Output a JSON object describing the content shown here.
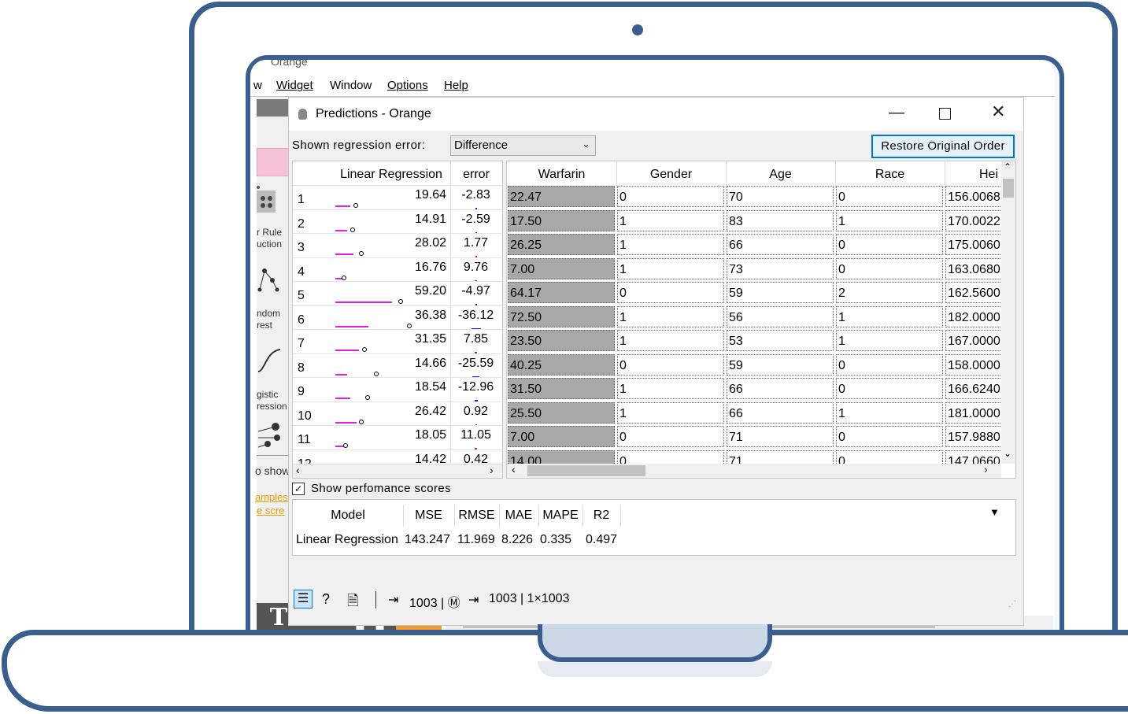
{
  "app": {
    "title": "Orange"
  },
  "menu": [
    "w",
    "Widget",
    "Window",
    "Options",
    "Help"
  ],
  "sidebar": {
    "labels": [
      "r Rule\nuction",
      "ndom\nrest",
      "gistic\nression"
    ],
    "show_label": "o show",
    "link1": "amples",
    "link2": "e scre"
  },
  "dialog": {
    "title": "Predictions - Orange",
    "error_label": "Shown regression error:",
    "error_value": "Difference",
    "restore_button": "Restore Original Order"
  },
  "pred_table": {
    "headers": [
      "Linear Regression",
      "error"
    ],
    "rows": [
      {
        "idx": "1",
        "pred": "19.64",
        "err": "-2.83",
        "bar": 0.1,
        "dot": 0.12,
        "ecolor": "#1a1aff",
        "ew": 2
      },
      {
        "idx": "2",
        "pred": "14.91",
        "err": "-2.59",
        "bar": 0.08,
        "dot": 0.1,
        "ecolor": "#1a1aff",
        "ew": 2
      },
      {
        "idx": "3",
        "pred": "28.02",
        "err": "1.77",
        "bar": 0.12,
        "dot": 0.16,
        "ecolor": "#e02020",
        "ew": 2
      },
      {
        "idx": "4",
        "pred": "16.76",
        "err": "9.76",
        "bar": 0.06,
        "dot": 0.04,
        "ecolor": "#e02020",
        "ew": 3
      },
      {
        "idx": "5",
        "pred": "59.20",
        "err": "-4.97",
        "bar": 0.38,
        "dot": 0.42,
        "ecolor": "#1a1aff",
        "ew": 2
      },
      {
        "idx": "6",
        "pred": "36.38",
        "err": "-36.12",
        "bar": 0.22,
        "dot": 0.48,
        "ecolor": "#1a1aff",
        "ew": 12
      },
      {
        "idx": "7",
        "pred": "31.35",
        "err": "7.85",
        "bar": 0.16,
        "dot": 0.18,
        "ecolor": "#e02020",
        "ew": 3
      },
      {
        "idx": "8",
        "pred": "14.66",
        "err": "-25.59",
        "bar": 0.08,
        "dot": 0.26,
        "ecolor": "#1a1aff",
        "ew": 9
      },
      {
        "idx": "9",
        "pred": "18.54",
        "err": "-12.96",
        "bar": 0.1,
        "dot": 0.2,
        "ecolor": "#1a1aff",
        "ew": 4
      },
      {
        "idx": "10",
        "pred": "26.42",
        "err": "0.92",
        "bar": 0.14,
        "dot": 0.16,
        "ecolor": "#e02020",
        "ew": 2
      },
      {
        "idx": "11",
        "pred": "18.05",
        "err": "11.05",
        "bar": 0.06,
        "dot": 0.05,
        "ecolor": "#e02020",
        "ew": 3
      },
      {
        "idx": "12",
        "pred": "14.42",
        "err": "0.42",
        "bar": 0.07,
        "dot": 0.08,
        "ecolor": "#e02020",
        "ew": 2
      }
    ]
  },
  "data_table": {
    "headers": [
      "Warfarin",
      "Gender",
      "Age",
      "Race",
      "Hei"
    ],
    "rows": [
      [
        "22.47",
        "0",
        "70",
        "0",
        "156.0068"
      ],
      [
        "17.50",
        "1",
        "83",
        "1",
        "170.0022"
      ],
      [
        "26.25",
        "1",
        "66",
        "0",
        "175.0060"
      ],
      [
        "7.00",
        "1",
        "73",
        "0",
        "163.0680"
      ],
      [
        "64.17",
        "0",
        "59",
        "2",
        "162.5600"
      ],
      [
        "72.50",
        "1",
        "56",
        "1",
        "182.0000"
      ],
      [
        "23.50",
        "1",
        "53",
        "1",
        "167.0000"
      ],
      [
        "40.25",
        "0",
        "59",
        "0",
        "158.0000"
      ],
      [
        "31.50",
        "1",
        "66",
        "0",
        "166.6240"
      ],
      [
        "25.50",
        "1",
        "66",
        "1",
        "181.0000"
      ],
      [
        "7.00",
        "0",
        "71",
        "0",
        "157.9880"
      ],
      [
        "14.00",
        "0",
        "71",
        "0",
        "147.0660"
      ]
    ]
  },
  "perf": {
    "checkbox_label": "Show perfomance scores",
    "checked": true,
    "headers": [
      "Model",
      "MSE",
      "RMSE",
      "MAE",
      "MAPE",
      "R2"
    ],
    "row": [
      "Linear Regression",
      "143.247",
      "11.969",
      "8.226",
      "0.335",
      "0.497"
    ]
  },
  "status": {
    "input_summary": "1003 | Ⓜ",
    "output_summary": "1003 | 1×1003"
  },
  "colors": {
    "frame": "#3a5f8e",
    "accent": "#0078d7",
    "dock_help": "#f29a2e",
    "prediction_bar": "#e020e0"
  }
}
